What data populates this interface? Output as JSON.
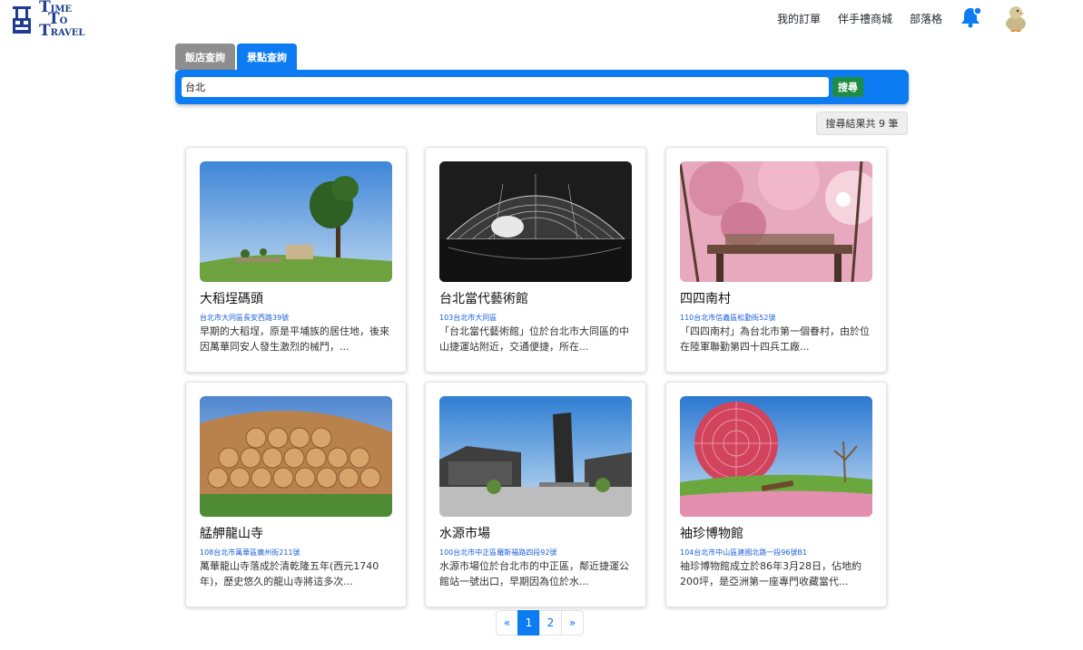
{
  "brand": {
    "line1": "IME",
    "line2": "O",
    "line3": "RAVEL",
    "cap1": "T",
    "cap2": "T",
    "cap3": "T"
  },
  "nav": {
    "orders": "我的訂單",
    "gift_shop": "伴手禮商城",
    "blog": "部落格"
  },
  "tabs": [
    {
      "label": "飯店查詢",
      "active": false
    },
    {
      "label": "景點查詢",
      "active": true
    }
  ],
  "search": {
    "value": "台北",
    "button": "搜尋"
  },
  "result_count": "搜尋結果共 9 筆",
  "cards": [
    {
      "title": "大稻埕碼頭",
      "address": "台北市大同區長安西路39號",
      "desc": "早期的大稻埕，原是平埔族的居住地，後來因萬華同安人發生激烈的械鬥，..."
    },
    {
      "title": "台北當代藝術館",
      "address": "103台北市大同區",
      "desc": "「台北當代藝術館」位於台北市大同區的中山捷運站附近，交通便捷，所在..."
    },
    {
      "title": "四四南村",
      "address": "110台北市信義區松勤街52號",
      "desc": "「四四南村」為台北市第一個眷村，由於位在陸軍聯勤第四十四兵工廠..."
    },
    {
      "title": "艋舺龍山寺",
      "address": "108台北市萬華區廣州街211號",
      "desc": "萬華龍山寺落成於清乾隆五年(西元1740年)，歷史悠久的龍山寺將這多次..."
    },
    {
      "title": "水源市場",
      "address": "100台北市中正區羅斯福路四段92號",
      "desc": "水源市場位於台北市的中正區，鄰近捷運公館站一號出口，早期因為位於水..."
    },
    {
      "title": "袖珍博物館",
      "address": "104台北市中山區建國北路一段96號B1",
      "desc": "袖珍博物館成立於86年3月28日，佔地約200坪，是亞洲第一座專門收藏當代..."
    }
  ],
  "pagination": {
    "prev": "«",
    "pages": [
      "1",
      "2"
    ],
    "next": "»",
    "current": "1"
  },
  "colors": {
    "primary": "#0d7cf2",
    "search_button": "#1e8c44",
    "tab_inactive": "#8e8e8e"
  }
}
